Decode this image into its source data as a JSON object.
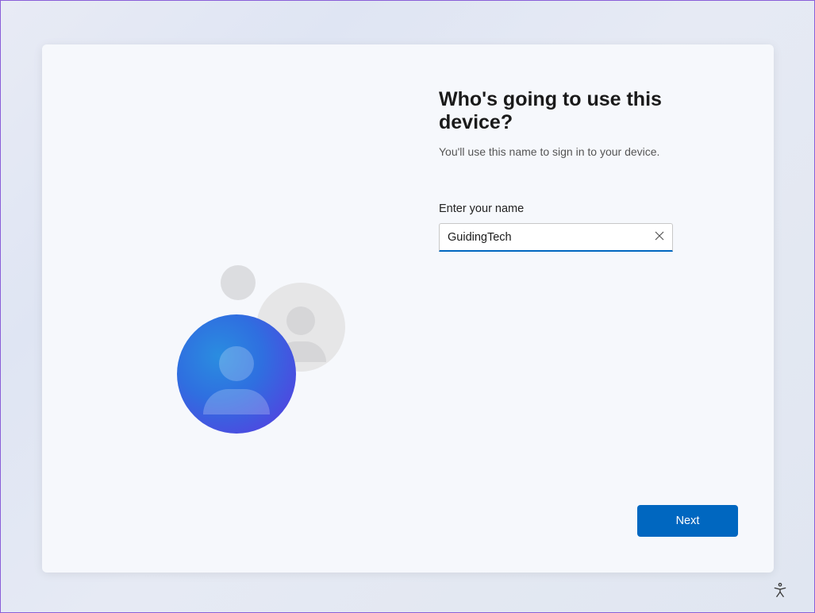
{
  "setup": {
    "title": "Who's going to use this device?",
    "subtitle": "You'll use this name to sign in to your device.",
    "field_label": "Enter your name",
    "name_value": "GuidingTech",
    "next_label": "Next"
  },
  "colors": {
    "accent": "#0067c0"
  }
}
